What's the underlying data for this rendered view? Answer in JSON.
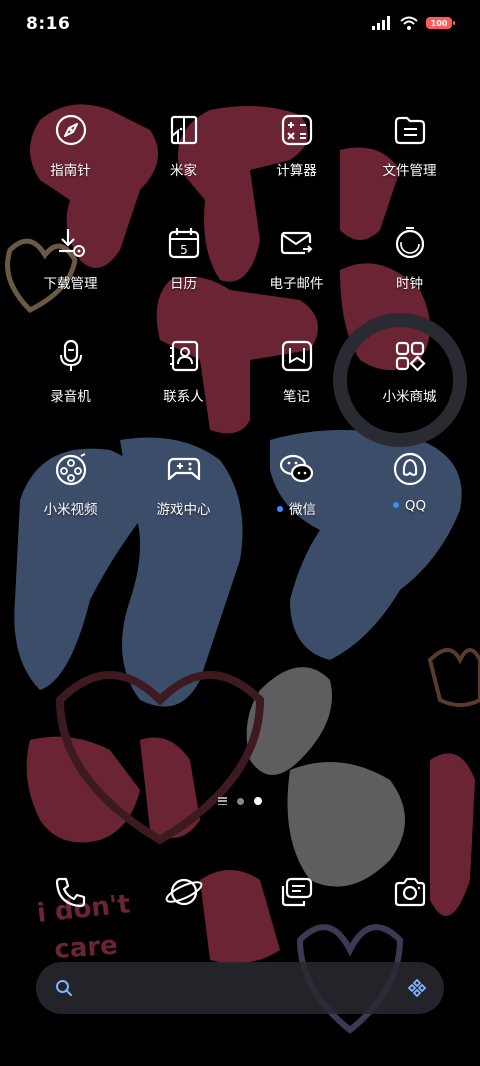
{
  "status_bar": {
    "time": "8:16",
    "battery": "100",
    "signal_icon": "signal-icon",
    "wifi_icon": "wifi-icon"
  },
  "apps": [
    {
      "label": "指南针",
      "icon": "compass-icon"
    },
    {
      "label": "米家",
      "icon": "home-icon"
    },
    {
      "label": "计算器",
      "icon": "calculator-icon"
    },
    {
      "label": "文件管理",
      "icon": "folder-icon"
    },
    {
      "label": "下载管理",
      "icon": "download-icon"
    },
    {
      "label": "日历",
      "icon": "calendar-icon",
      "day": "5"
    },
    {
      "label": "电子邮件",
      "icon": "mail-icon"
    },
    {
      "label": "时钟",
      "icon": "clock-icon"
    },
    {
      "label": "录音机",
      "icon": "microphone-icon"
    },
    {
      "label": "联系人",
      "icon": "contacts-icon"
    },
    {
      "label": "笔记",
      "icon": "notes-icon"
    },
    {
      "label": "小米商城",
      "icon": "store-icon"
    },
    {
      "label": "小米视频",
      "icon": "video-icon"
    },
    {
      "label": "游戏中心",
      "icon": "gamepad-icon"
    },
    {
      "label": "微信",
      "icon": "wechat-icon",
      "new": true
    },
    {
      "label": "QQ",
      "icon": "qq-icon",
      "new": true
    }
  ],
  "dock": [
    {
      "icon": "phone-icon"
    },
    {
      "icon": "browser-icon"
    },
    {
      "icon": "messages-icon"
    },
    {
      "icon": "camera-icon"
    }
  ],
  "wallpaper_text": {
    "sticker_line1": "i don't",
    "sticker_line2": "care"
  },
  "colors": {
    "wallpaper_red": "#6b2433",
    "wallpaper_blue": "#3c4d6a",
    "wallpaper_gray": "#5e5e60",
    "notification_dot": "#3b8bff",
    "battery": "#ff5a5a"
  }
}
